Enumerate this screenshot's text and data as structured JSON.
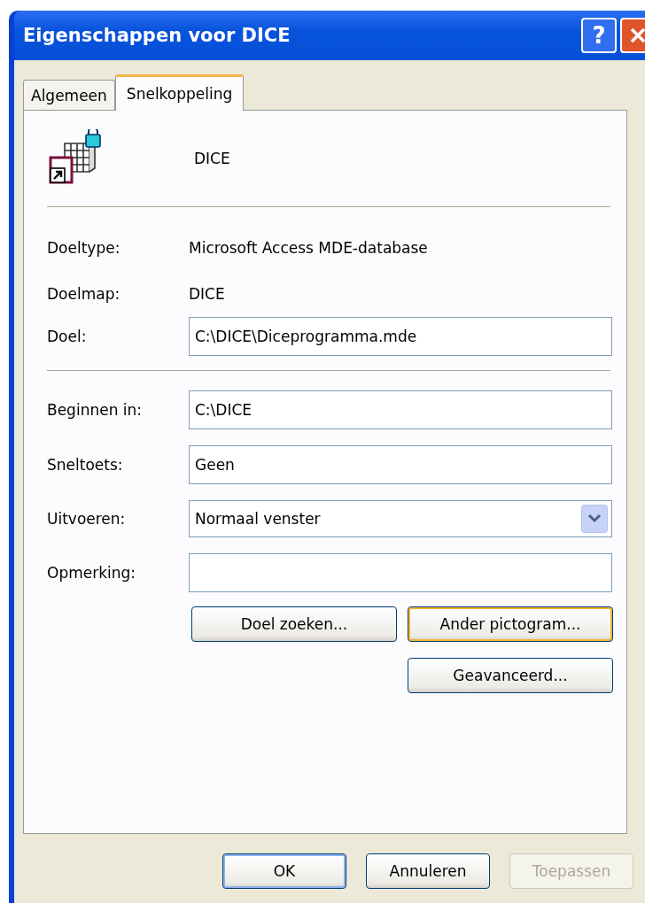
{
  "window": {
    "title": "Eigenschappen voor DICE"
  },
  "title_buttons": [
    {
      "kind": "help",
      "label": "?"
    },
    {
      "kind": "close"
    }
  ],
  "tabs": [
    {
      "label": "Algemeen",
      "selected": false
    },
    {
      "label": "Snelkoppeling",
      "selected": true
    }
  ],
  "header": {
    "name": "DICE"
  },
  "info_rows": [
    {
      "label": "Doeltype:",
      "value": "Microsoft Access MDE-database"
    },
    {
      "label": "Doelmap:",
      "value": "DICE"
    }
  ],
  "target_field": {
    "label": "Doel:",
    "value": "C:\\DICE\\Diceprogramma.mde"
  },
  "fields": [
    {
      "kind": "text",
      "label": "Beginnen in:",
      "value": "C:\\DICE"
    },
    {
      "kind": "text",
      "label": "Sneltoets:",
      "value": "Geen"
    },
    {
      "kind": "select",
      "label": "Uitvoeren:",
      "value": "Normaal venster"
    },
    {
      "kind": "text",
      "label": "Opmerking:"
    }
  ],
  "action_buttons": [
    {
      "label": "Doel zoeken...",
      "focused": false
    },
    {
      "label": "Ander pictogram...",
      "focused": true
    },
    {
      "label": "Geavanceerd...",
      "focused": false
    }
  ],
  "dialog_buttons": [
    {
      "label": "OK",
      "default": true,
      "disabled": false
    },
    {
      "label": "Annuleren",
      "default": false,
      "disabled": false
    },
    {
      "label": "Toepassen",
      "default": false,
      "disabled": true
    }
  ]
}
